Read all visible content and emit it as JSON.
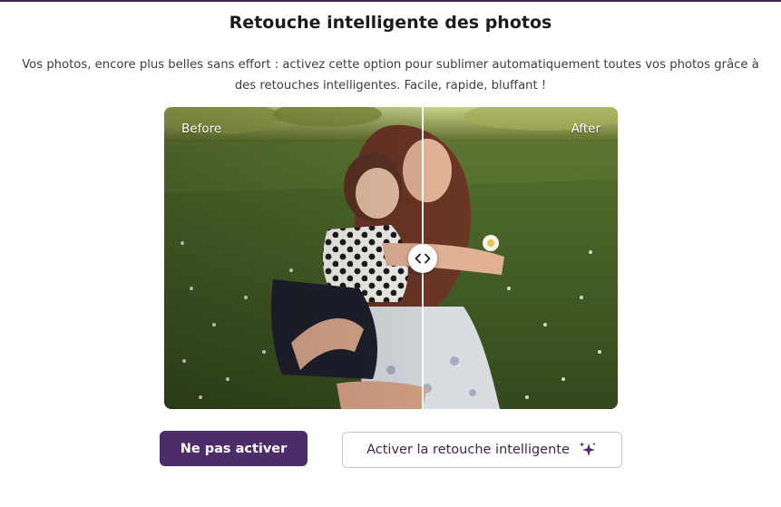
{
  "dialog": {
    "title": "Retouche intelligente des photos",
    "description": "Vos photos, encore plus belles sans effort : activez cette option pour sublimer automatiquement toutes vos photos grâce à des retouches intelligentes. Facile, rapide, bluffant !"
  },
  "comparison": {
    "before_label": "Before",
    "after_label": "After",
    "slider_position": 0.57,
    "handle_icon": "chevrons-left-right-icon"
  },
  "actions": {
    "decline_label": "Ne pas activer",
    "activate_label": "Activer la retouche intelligente",
    "activate_icon": "sparkles-icon"
  },
  "colors": {
    "brand_purple": "#4e2c6a",
    "text_dark": "#1c1c1c",
    "border_gray": "#c9c5cf"
  }
}
